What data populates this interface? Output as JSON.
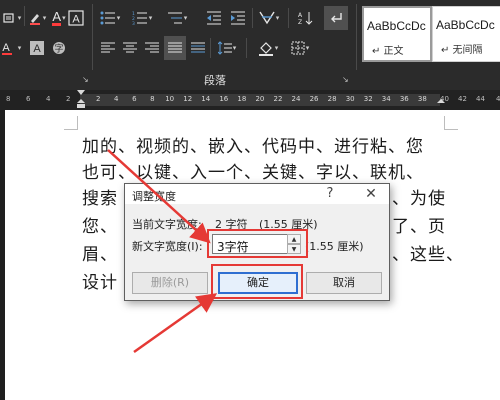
{
  "ribbon": {
    "font_color_letter": "A",
    "styles": [
      {
        "sample": "AaBbCcDc",
        "name": "↵ 正文"
      },
      {
        "sample": "AaBbCcDc",
        "name": "↵ 无间隔"
      }
    ],
    "paragraph_group_label": "段落"
  },
  "ruler": {
    "numbers_left": [
      "8",
      "6",
      "4",
      "2"
    ],
    "numbers_main": [
      "2",
      "4",
      "6",
      "8",
      "10",
      "12",
      "14",
      "16",
      "18",
      "20",
      "22",
      "24",
      "26",
      "28",
      "30",
      "32",
      "34",
      "36",
      "38"
    ],
    "numbers_right": [
      "40",
      "42",
      "44",
      "4"
    ]
  },
  "document": {
    "lines": [
      "加的、视频的、嵌入、代码中、进行粘、您",
      "也可、以键、入一个、关键、字以、联机、",
      "搜索",
      "您、",
      "眉、",
      "设计"
    ],
    "line_tails": [
      "",
      "",
      "、为使",
      "了、页",
      "、这些、",
      ""
    ]
  },
  "dialog": {
    "title": "调整宽度",
    "help": "?",
    "close": "✕",
    "current_width_label": "当前文字宽度:",
    "current_width_value": "2 字符",
    "current_width_cm": "(1.55 厘米)",
    "new_width_label": "新文字宽度(I):",
    "new_width_value": "3字符",
    "new_width_cm": "(1.55 厘米)",
    "delete_button": "删除(R)",
    "ok_button": "确定",
    "cancel_button": "取消"
  },
  "colors": {
    "ribbon_bg": "#2b2b2b",
    "annotation_red": "#e53935",
    "ok_border": "#2f6fd1",
    "dialog_bg": "#f0f0f0"
  }
}
